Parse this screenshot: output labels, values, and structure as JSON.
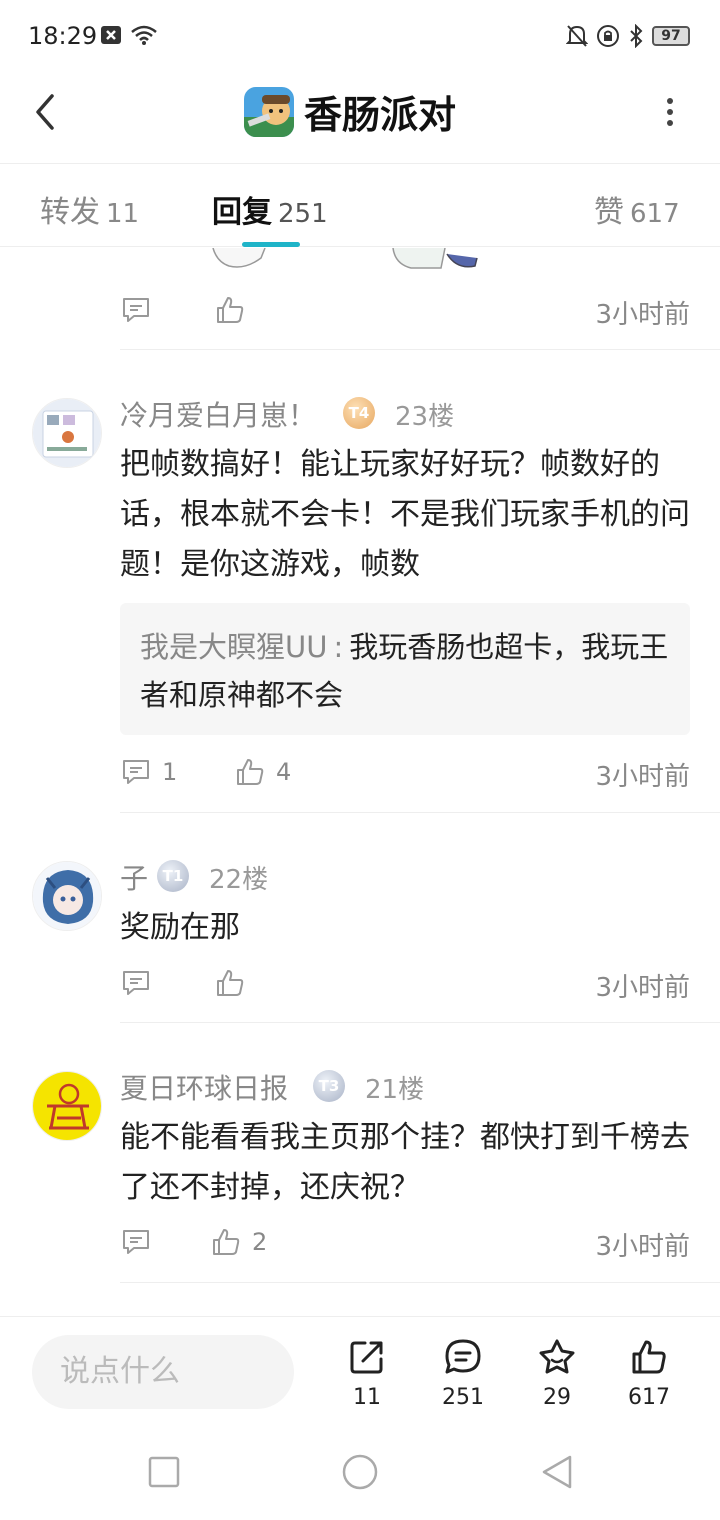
{
  "status_bar": {
    "time": "18:29",
    "battery": "97"
  },
  "header": {
    "title": "香肠派对",
    "back_icon": "chevron-left-icon",
    "more_icon": "more-vertical-icon"
  },
  "tabs": [
    {
      "label": "转发",
      "count": "11"
    },
    {
      "label": "回复",
      "count": "251",
      "active": true
    },
    {
      "label": "赞",
      "count": "617"
    }
  ],
  "accent_color": "#1fb4c8",
  "top_item": {
    "time": "3小时前"
  },
  "replies": [
    {
      "name": "冷月爱白月崽！",
      "badge": "T4",
      "floor": "23楼",
      "content": "把帧数搞好！能让玩家好好玩？帧数好的话，根本就不会卡！不是我们玩家手机的问题！是你这游戏，帧数",
      "quote_name": "我是大瞑猩UU",
      "quote_sep": ":",
      "quote_text": "我玩香肠也超卡，我玩王者和原神都不会",
      "comments": "1",
      "likes": "4",
      "time": "3小时前"
    },
    {
      "name": "子",
      "badge": "T1",
      "floor": "22楼",
      "content": "奖励在那",
      "time": "3小时前"
    },
    {
      "name": "夏日环球日报",
      "badge": "T3",
      "floor": "21楼",
      "content": "能不能看看我主页那个挂？都快打到千榜去了还不封掉，还庆祝？",
      "likes": "2",
      "time": "3小时前"
    }
  ],
  "bottom_bar": {
    "placeholder": "说点什么",
    "share_count": "11",
    "comment_count": "251",
    "favorite_count": "29",
    "like_count": "617"
  }
}
